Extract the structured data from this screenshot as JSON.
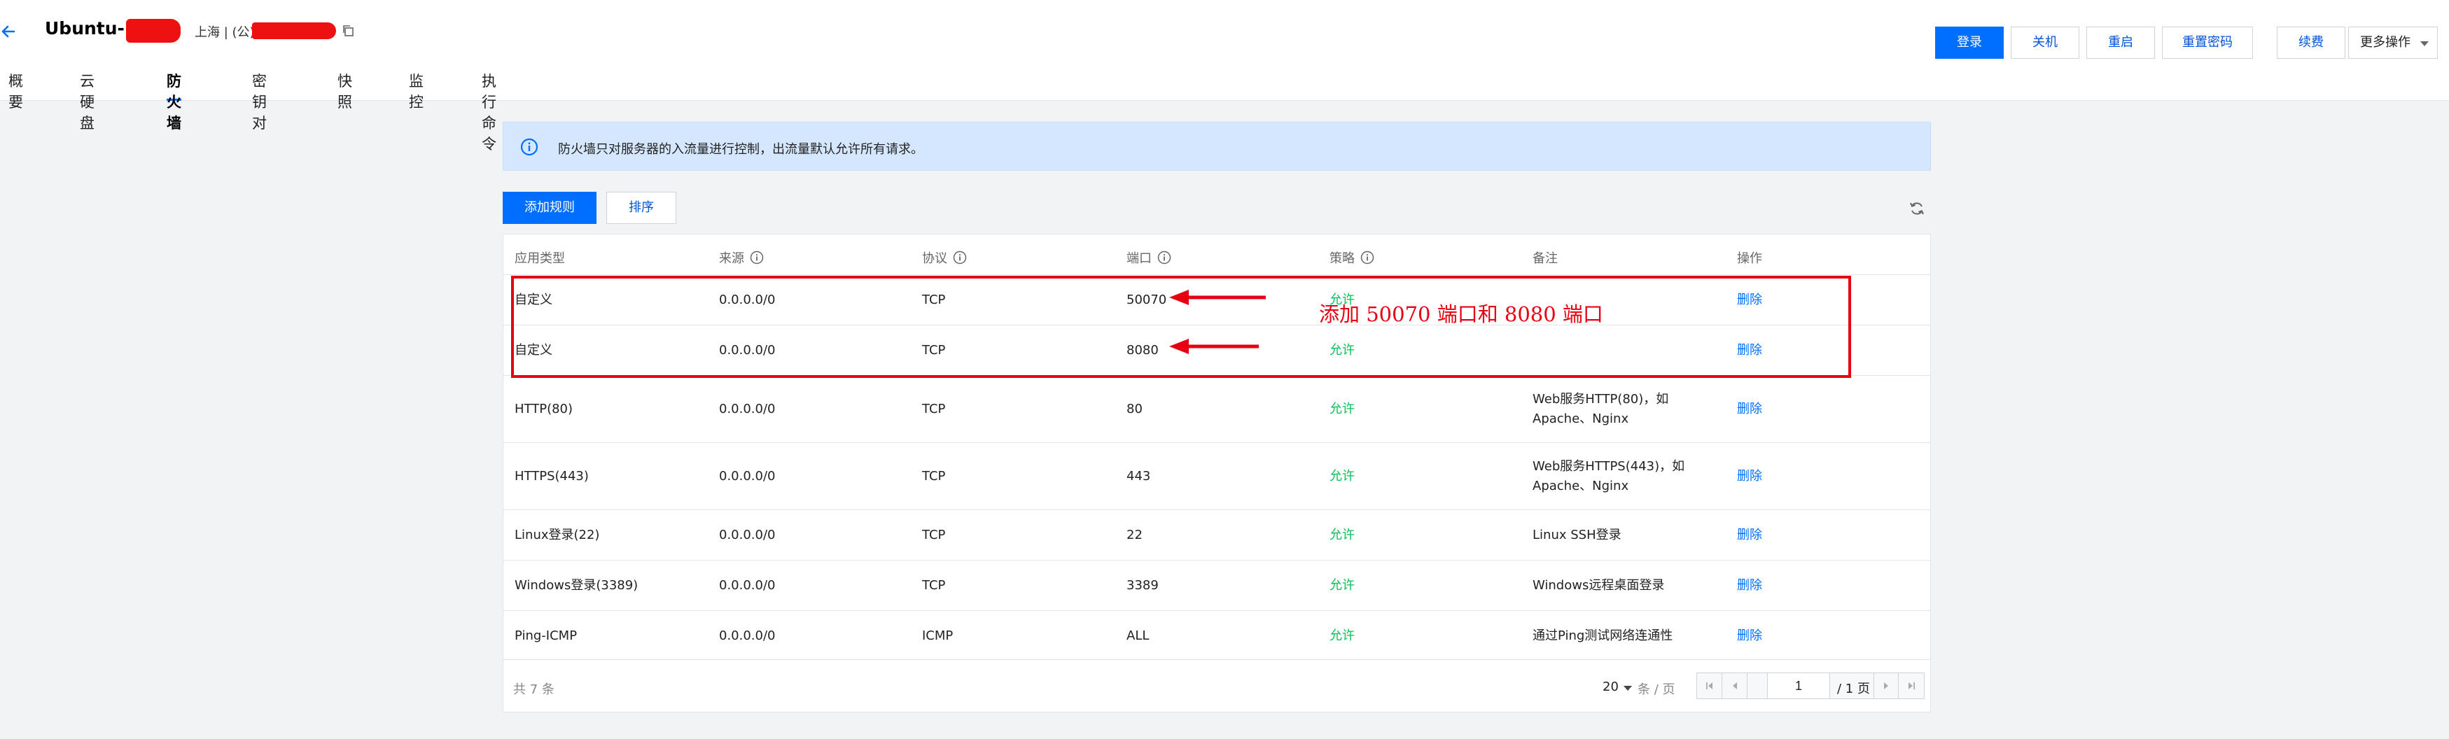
{
  "header": {
    "title": "Ubuntu-",
    "region": "上海 | (公)",
    "actions": {
      "login": "登录",
      "shutdown": "关机",
      "restart": "重启",
      "reset_password": "重置密码",
      "renew": "续费",
      "more": "更多操作"
    }
  },
  "tabs": [
    {
      "label": "概要",
      "active": false
    },
    {
      "label": "云硬盘",
      "active": false
    },
    {
      "label": "防火墙",
      "active": true
    },
    {
      "label": "密钥对",
      "active": false
    },
    {
      "label": "快照",
      "active": false
    },
    {
      "label": "监控",
      "active": false
    },
    {
      "label": "执行命令",
      "active": false
    }
  ],
  "notice": "防火墙只对服务器的入流量进行控制，出流量默认允许所有请求。",
  "toolbar": {
    "add_rule": "添加规则",
    "sort": "排序"
  },
  "table": {
    "columns": [
      "应用类型",
      "来源",
      "协议",
      "端口",
      "策略",
      "备注",
      "操作"
    ],
    "rows": [
      {
        "type": "自定义",
        "source": "0.0.0.0/0",
        "protocol": "TCP",
        "port": "50070",
        "policy": "允许",
        "note": "",
        "action": "删除"
      },
      {
        "type": "自定义",
        "source": "0.0.0.0/0",
        "protocol": "TCP",
        "port": "8080",
        "policy": "允许",
        "note": "",
        "action": "删除"
      },
      {
        "type": "HTTP(80)",
        "source": "0.0.0.0/0",
        "protocol": "TCP",
        "port": "80",
        "policy": "允许",
        "note": "Web服务HTTP(80)，如Apache、Nginx",
        "action": "删除"
      },
      {
        "type": "HTTPS(443)",
        "source": "0.0.0.0/0",
        "protocol": "TCP",
        "port": "443",
        "policy": "允许",
        "note": "Web服务HTTPS(443)，如Apache、Nginx",
        "action": "删除"
      },
      {
        "type": "Linux登录(22)",
        "source": "0.0.0.0/0",
        "protocol": "TCP",
        "port": "22",
        "policy": "允许",
        "note": "Linux SSH登录",
        "action": "删除"
      },
      {
        "type": "Windows登录(3389)",
        "source": "0.0.0.0/0",
        "protocol": "TCP",
        "port": "3389",
        "policy": "允许",
        "note": "Windows远程桌面登录",
        "action": "删除"
      },
      {
        "type": "Ping-ICMP",
        "source": "0.0.0.0/0",
        "protocol": "ICMP",
        "port": "ALL",
        "policy": "允许",
        "note": "通过Ping测试网络连通性",
        "action": "删除"
      }
    ]
  },
  "footer": {
    "total": "共 7 条",
    "page_size": "20",
    "per_page": "条 / 页",
    "current_page": "1",
    "page_of": "/ 1 页"
  },
  "annotation": {
    "text": "添加 50070 端口和 8080 端口",
    "color": "#e60012"
  },
  "colors": {
    "primary": "#006eff",
    "allow": "#0abf5b",
    "notice_bg": "#d5e7ff"
  }
}
